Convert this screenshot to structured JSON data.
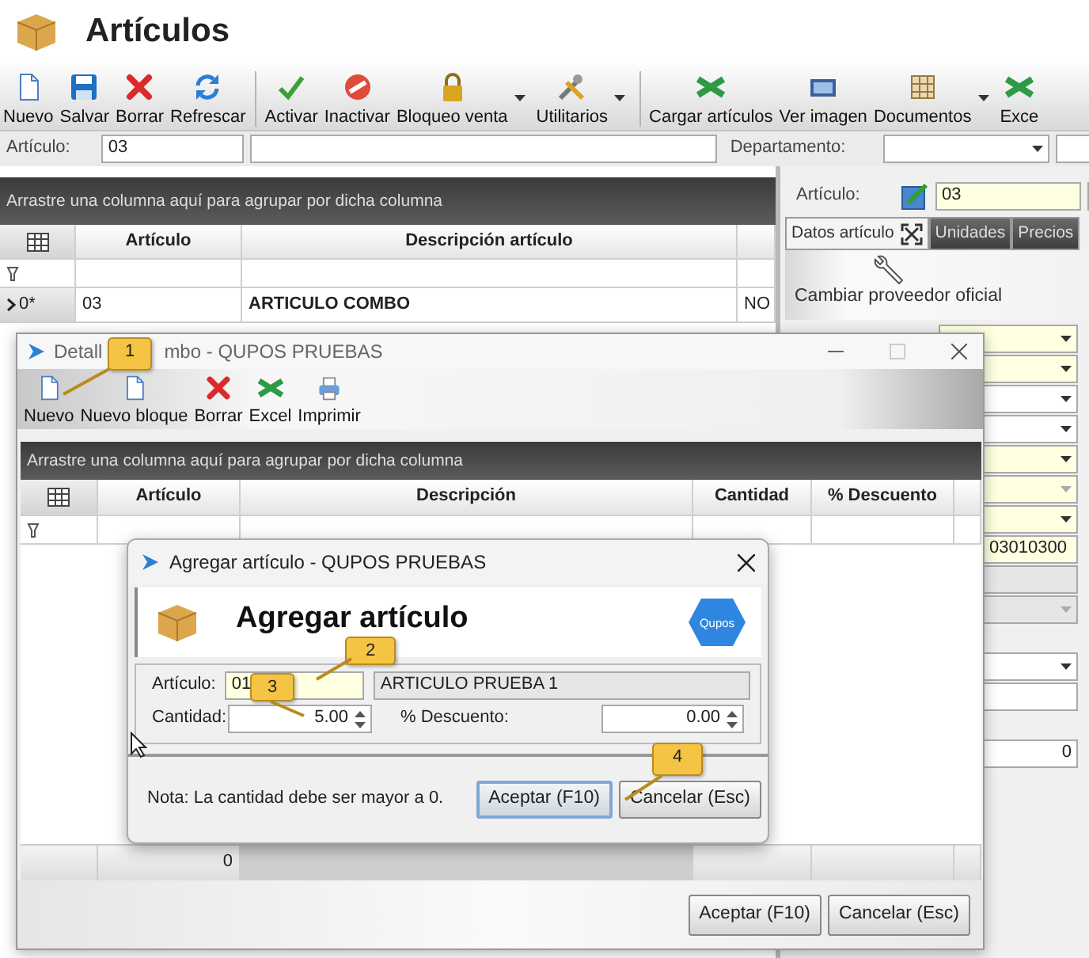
{
  "window": {
    "title": "Artículos"
  },
  "toolbar": [
    {
      "label": "Nuevo",
      "kind": "new",
      "separator_before": false,
      "dropdown": false
    },
    {
      "label": "Salvar",
      "kind": "save",
      "separator_before": false,
      "dropdown": false
    },
    {
      "label": "Borrar",
      "kind": "delete",
      "separator_before": false,
      "dropdown": false
    },
    {
      "label": "Refrescar",
      "kind": "refresh",
      "separator_before": false,
      "dropdown": false
    },
    {
      "label": "Activar",
      "kind": "activate",
      "separator_before": true,
      "dropdown": false
    },
    {
      "label": "Inactivar",
      "kind": "deactivate",
      "separator_before": false,
      "dropdown": false
    },
    {
      "label": "Bloqueo venta",
      "kind": "lock",
      "separator_before": false,
      "dropdown": true
    },
    {
      "label": "Utilitarios",
      "kind": "tools",
      "separator_before": false,
      "dropdown": true
    },
    {
      "label": "Cargar artículos",
      "kind": "excel",
      "separator_before": true,
      "dropdown": false
    },
    {
      "label": "Ver imagen",
      "kind": "image",
      "separator_before": false,
      "dropdown": false
    },
    {
      "label": "Documentos",
      "kind": "documents",
      "separator_before": false,
      "dropdown": true
    },
    {
      "label": "Exce",
      "kind": "excel",
      "separator_before": false,
      "dropdown": false
    }
  ],
  "filter_bar": {
    "articulo_label": "Artículo:",
    "articulo_value": "03",
    "departamento_label": "Departamento:"
  },
  "grid": {
    "group_hint": "Arrastre una columna aquí para agrupar por dicha columna",
    "columns": [
      "Artículo",
      "Descripción artículo"
    ],
    "rows": [
      {
        "indicator": "0*",
        "current": true,
        "cells": [
          "03",
          "ARTICULO COMBO",
          "NO"
        ]
      }
    ]
  },
  "detail_panel": {
    "articulo_label": "Artículo:",
    "articulo_value": "03",
    "tabs": [
      {
        "label": "Datos artículo",
        "selected": true
      },
      {
        "label": "Unidades",
        "selected": false
      },
      {
        "label": "Precios",
        "selected": false
      }
    ],
    "action": "Cambiar proveedor oficial",
    "field_groups": [
      [
        {
          "kind": "dropdown",
          "highlighted": true,
          "disabled": false
        },
        {
          "kind": "dropdown",
          "highlighted": true,
          "disabled": false
        },
        {
          "kind": "dropdown",
          "highlighted": false,
          "disabled": false
        },
        {
          "kind": "dropdown",
          "highlighted": false,
          "disabled": false
        },
        {
          "kind": "dropdown",
          "highlighted": true,
          "disabled": false
        },
        {
          "kind": "dropdown",
          "highlighted": true,
          "disabled": true
        },
        {
          "kind": "dropdown",
          "highlighted": true,
          "disabled": false
        },
        {
          "kind": "wide",
          "value": "03010300",
          "highlighted": true,
          "disabled": false
        },
        {
          "kind": "text",
          "highlighted": false,
          "disabled": true
        },
        {
          "kind": "dropdown",
          "highlighted": false,
          "disabled": true
        }
      ],
      [
        {
          "kind": "dropdown",
          "highlighted": false,
          "disabled": false
        },
        {
          "kind": "text",
          "highlighted": false,
          "disabled": false
        }
      ],
      [
        {
          "kind": "number",
          "value": "0",
          "highlighted": false,
          "disabled": false
        }
      ]
    ]
  },
  "detail_window": {
    "title_parts": [
      "Detall",
      "mbo - QUPOS PRUEBAS"
    ],
    "toolbar": [
      {
        "label": "Nuevo",
        "kind": "new"
      },
      {
        "label": "Nuevo bloque",
        "kind": "new"
      },
      {
        "label": "Borrar",
        "kind": "delete"
      },
      {
        "label": "Excel",
        "kind": "excel"
      },
      {
        "label": "Imprimir",
        "kind": "print"
      }
    ],
    "group_hint": "Arrastre una columna aquí para agrupar por dicha columna",
    "columns": [
      "Artículo",
      "Descripción",
      "Cantidad",
      "% Descuento"
    ],
    "footer_total": "0",
    "buttons": [
      "Aceptar (F10)",
      "Cancelar (Esc)"
    ]
  },
  "add_dialog": {
    "title": "Agregar artículo - QUPOS PRUEBAS",
    "heading": "Agregar artículo",
    "logo_text": "Qupos",
    "articulo_label": "Artículo:",
    "articulo_value": "01",
    "description": "ARTICULO PRUEBA 1",
    "cantidad_label": "Cantidad:",
    "cantidad_value": "5.00",
    "descuento_label": "% Descuento:",
    "descuento_value": "0.00",
    "note": "Nota: La cantidad debe ser mayor a 0.",
    "buttons": [
      {
        "label": "Aceptar (F10)",
        "focused": true
      },
      {
        "label": "Cancelar (Esc)",
        "focused": false
      }
    ]
  },
  "callouts": [
    "1",
    "2",
    "3",
    "4"
  ]
}
